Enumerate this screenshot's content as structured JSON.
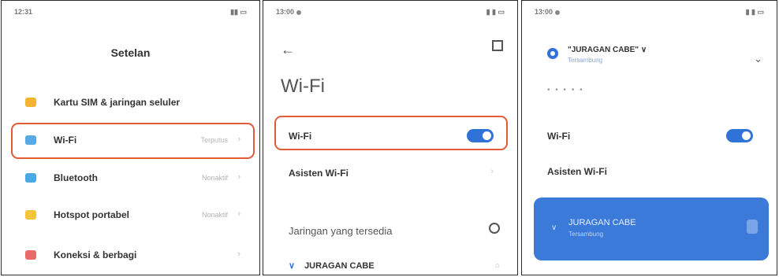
{
  "panel1": {
    "status_time": "12:31",
    "title": "Setelan",
    "items": [
      {
        "label": "Kartu SIM & jaringan seluler",
        "value": "",
        "icon_color": "#f2b531"
      },
      {
        "label": "Wi-Fi",
        "value": "Terputus",
        "icon_color": "#59a9e6"
      },
      {
        "label": "Bluetooth",
        "value": "Nonaktif",
        "icon_color": "#4aa8e2"
      },
      {
        "label": "Hotspot portabel",
        "value": "Nonaktif",
        "icon_color": "#f2c53d"
      },
      {
        "label": "Koneksi & berbagi",
        "value": "",
        "icon_color": "#e96a6a"
      }
    ]
  },
  "panel2": {
    "status_time": "13:00",
    "title": "Wi-Fi",
    "wifi_label": "Wi-Fi",
    "wifi_on": true,
    "assistant_label": "Asisten Wi-Fi",
    "section_label": "Jaringan yang tersedia",
    "network": "JURAGAN CABE"
  },
  "panel3": {
    "status_time": "13:00",
    "connected_name": "\"JURAGAN CABE\" ∨",
    "connected_status": "Tersambung",
    "wifi_label": "Wi-Fi",
    "assistant_label": "Asisten Wi-Fi",
    "card_name": "JURAGAN CABE",
    "card_status": "Tersambung"
  },
  "colors": {
    "highlight": "#e35b34",
    "accent": "#2f72d8"
  }
}
